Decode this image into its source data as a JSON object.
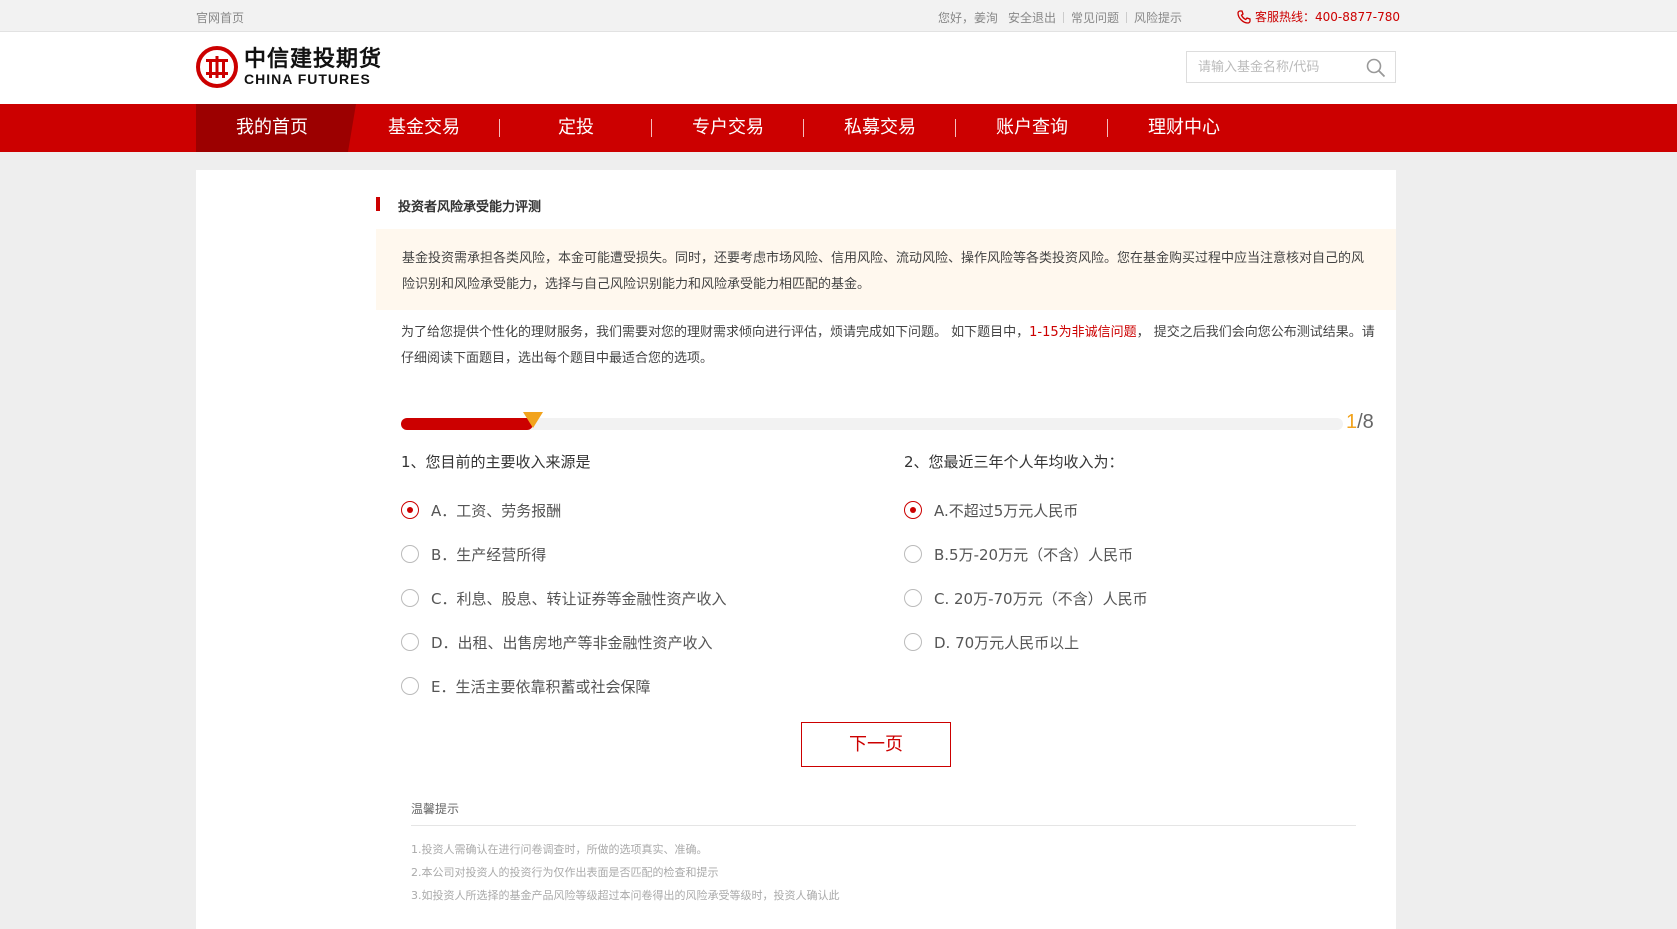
{
  "topbar": {
    "home_link": "官网首页",
    "greeting": "您好，姜洵",
    "logout": "安全退出",
    "faq": "常见问题",
    "risk_tip": "风险提示",
    "hotline": "客服热线：400-8877-780"
  },
  "header": {
    "logo_zh": "中信建投期货",
    "logo_en": "CHINA FUTURES",
    "search_placeholder": "请输入基金名称/代码"
  },
  "nav": {
    "items": [
      {
        "label": "我的首页",
        "active": true
      },
      {
        "label": "基金交易",
        "active": false
      },
      {
        "label": "定投",
        "active": false
      },
      {
        "label": "专户交易",
        "active": false
      },
      {
        "label": "私募交易",
        "active": false
      },
      {
        "label": "账户查询",
        "active": false
      },
      {
        "label": "理财中心",
        "active": false
      }
    ]
  },
  "main": {
    "section_title": "投资者风险承受能力评测",
    "notice": "基金投资需承担各类风险，本金可能遭受损失。同时，还要考虑市场风险、信用风险、流动风险、操作风险等各类投资风险。您在基金购买过程中应当注意核对自己的风险识别和风险承受能力，选择与自己风险识别能力和风险承受能力相匹配的基金。",
    "intro_part1": "为了给您提供个性化的理财服务，我们需要对您的理财需求倾向进行评估，烦请完成如下问题。 如下题目中，",
    "intro_highlight": "1-15为非诚信问题",
    "intro_part2": "， 提交之后我们会向您公布测试结果。请仔细阅读下面题目，选出每个题目中最适合您的选项。",
    "progress": {
      "current": "1",
      "total": "/8",
      "fraction": 0.14
    },
    "questions": [
      {
        "title": "1、您目前的主要收入来源是",
        "options": [
          {
            "label": "A．工资、劳务报酬",
            "checked": true
          },
          {
            "label": "B．生产经营所得",
            "checked": false
          },
          {
            "label": "C．利息、股息、转让证券等金融性资产收入",
            "checked": false
          },
          {
            "label": "D．出租、出售房地产等非金融性资产收入",
            "checked": false
          },
          {
            "label": "E．生活主要依靠积蓄或社会保障",
            "checked": false
          }
        ]
      },
      {
        "title": "2、您最近三年个人年均收入为：",
        "options": [
          {
            "label": "A.不超过5万元人民币",
            "checked": true
          },
          {
            "label": "B.5万-20万元（不含）人民币",
            "checked": false
          },
          {
            "label": "C. 20万-70万元（不含）人民币",
            "checked": false
          },
          {
            "label": "D. 70万元人民币以上",
            "checked": false
          }
        ]
      }
    ],
    "next_button": "下一页",
    "tips": {
      "title": "温馨提示",
      "lines": [
        "1.投资人需确认在进行问卷调查时，所做的选项真实、准确。",
        "2.本公司对投资人的投资行为仅作出表面是否匹配的检查和提示",
        "3.如投资人所选择的基金产品风险等级超过本问卷得出的风险承受等级时，投资人确认此"
      ]
    }
  },
  "colors": {
    "brand_red": "#cc0000",
    "accent_orange": "#f2a31c",
    "notice_bg": "#fff8ee"
  }
}
